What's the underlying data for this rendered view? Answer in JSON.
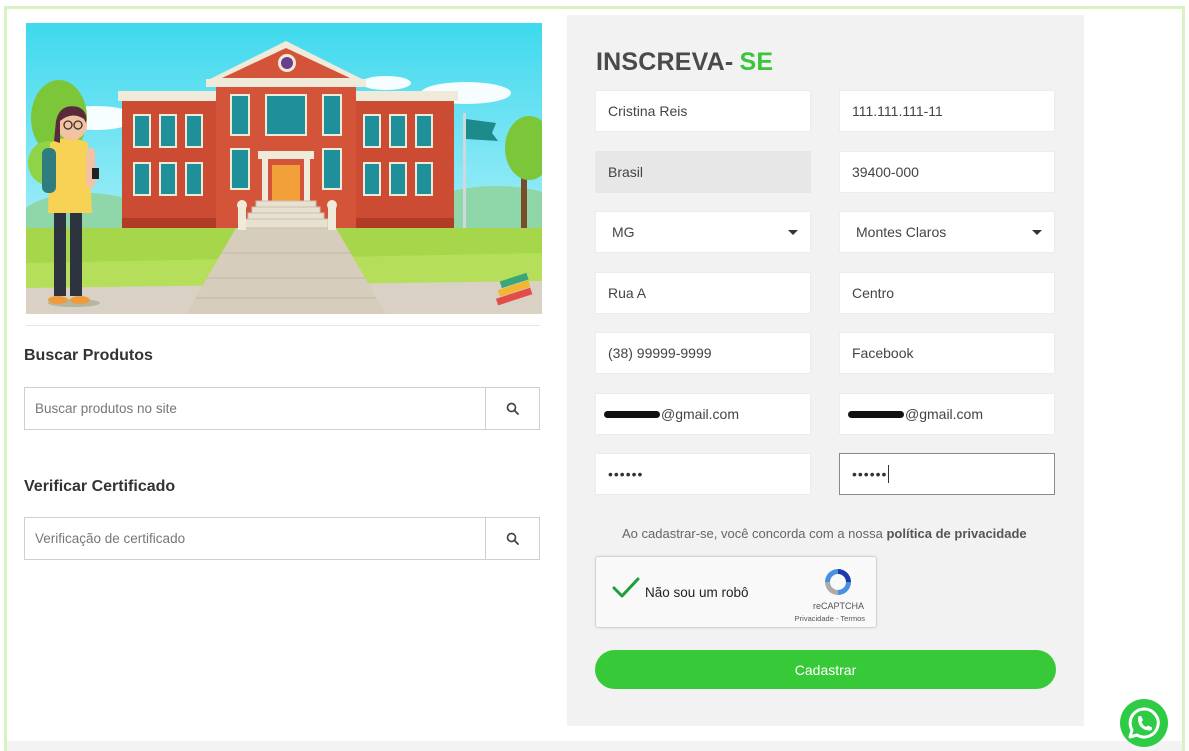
{
  "widgets": {
    "search_products": {
      "title": "Buscar Produtos",
      "placeholder": "Buscar produtos no site",
      "button_icon": "search-icon"
    },
    "verify_certificate": {
      "title": "Verificar Certificado",
      "placeholder": "Verificação de certificado",
      "button_icon": "search-icon"
    }
  },
  "signup": {
    "title_main": "INSCREVA-",
    "title_accent": "SE",
    "accent_color": "#3bc53b",
    "fields": {
      "name": "Cristina Reis",
      "cpf": "111.111.111-11",
      "country": "Brasil",
      "cep": "39400-000",
      "state": "MG",
      "city": "Montes Claros",
      "street": "Rua A",
      "neighborhood": "Centro",
      "phone": "(38) 99999-9999",
      "source": "Facebook",
      "email_suffix": "@gmail.com",
      "confirm_email_suffix": "@gmail.com",
      "password_mask": "••••••",
      "confirm_password_mask": "••••••"
    },
    "terms_prefix": "Ao cadastrar-se, você concorda com a nossa",
    "terms_link": "política de privacidade",
    "recaptcha": {
      "label": "Não sou um robô",
      "brand": "reCAPTCHA",
      "privacy": "Privacidade",
      "separator": " - ",
      "terms": "Termos",
      "checked": true
    },
    "submit_label": "Cadastrar",
    "submit_color": "#38c938"
  },
  "floating": {
    "whatsapp_icon": "whatsapp-icon",
    "whatsapp_color": "#2ecc45"
  }
}
